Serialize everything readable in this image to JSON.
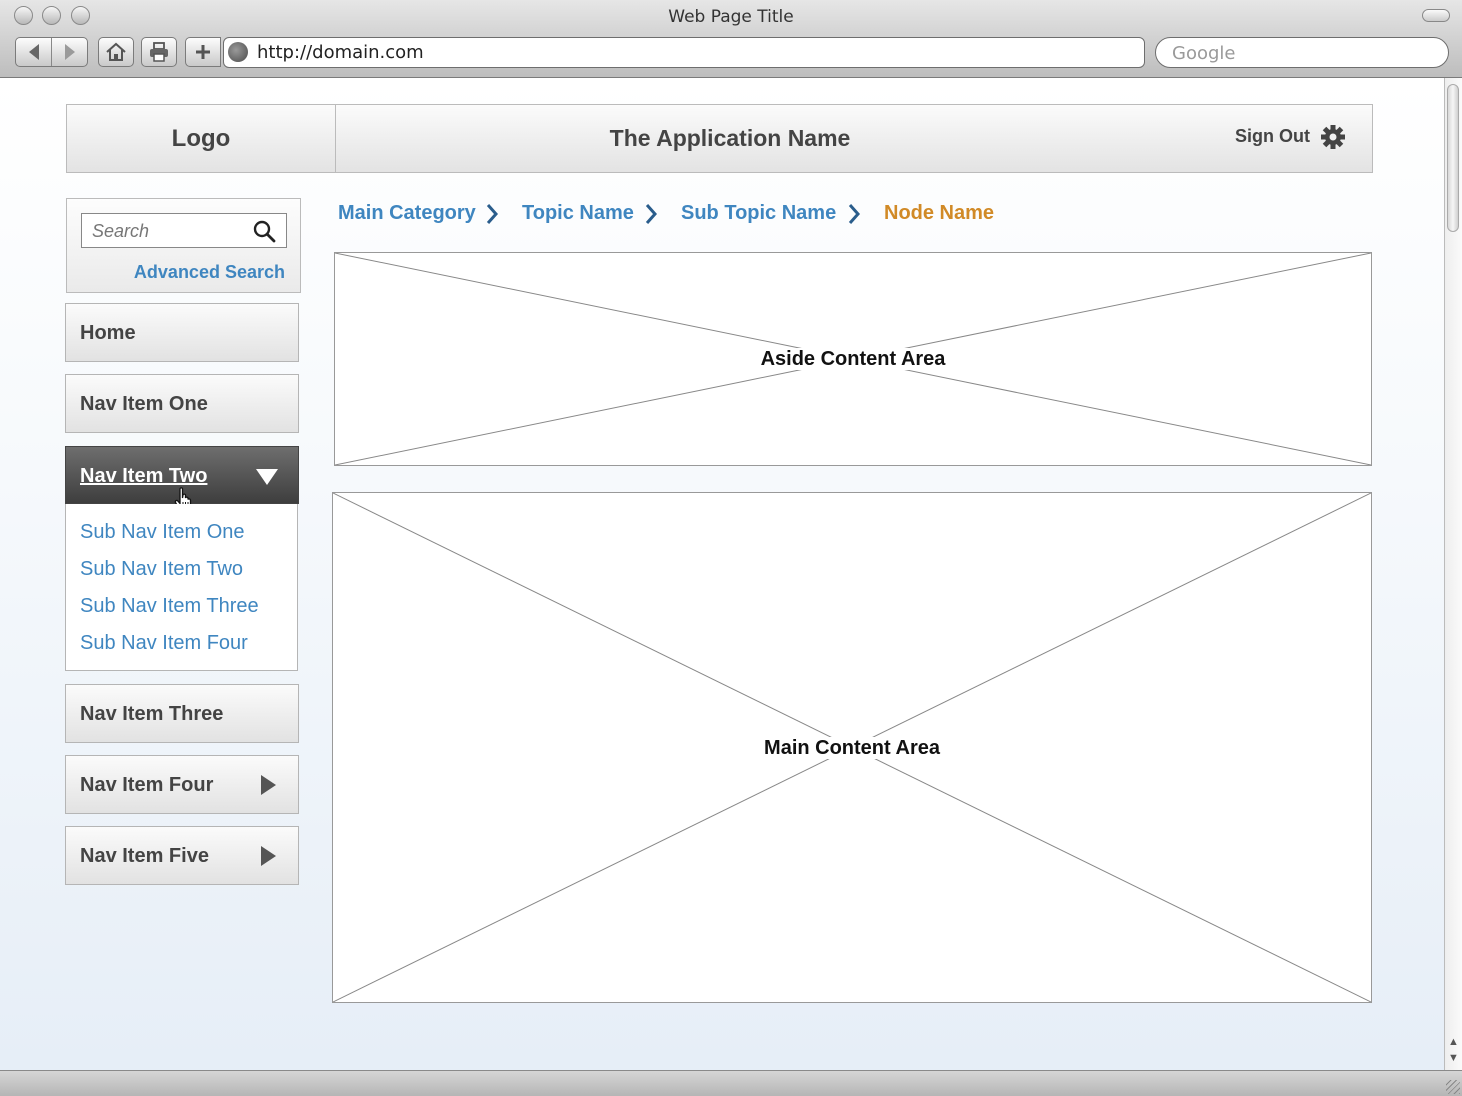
{
  "browser": {
    "window_title": "Web Page Title",
    "url": "http://domain.com",
    "search_placeholder": "Google"
  },
  "header": {
    "logo": "Logo",
    "app_name": "The Application Name",
    "sign_out": "Sign Out"
  },
  "search": {
    "placeholder": "Search",
    "advanced": "Advanced Search"
  },
  "nav": {
    "items": [
      {
        "label": "Home"
      },
      {
        "label": "Nav Item One"
      },
      {
        "label": "Nav Item Two",
        "active": true
      },
      {
        "label": "Nav Item Three"
      },
      {
        "label": "Nav Item Four",
        "has_submenu": true
      },
      {
        "label": "Nav Item Five",
        "has_submenu": true
      }
    ],
    "sub_items": [
      {
        "label": "Sub Nav Item One"
      },
      {
        "label": "Sub Nav Item Two"
      },
      {
        "label": "Sub Nav Item Three"
      },
      {
        "label": "Sub Nav Item Four"
      }
    ]
  },
  "breadcrumb": {
    "items": [
      {
        "label": "Main Category"
      },
      {
        "label": "Topic Name"
      },
      {
        "label": "Sub Topic Name"
      },
      {
        "label": "Node Name",
        "current": true
      }
    ]
  },
  "content": {
    "aside_label": "Aside Content Area",
    "main_label": "Main Content Area"
  },
  "colors": {
    "link": "#3f86c0",
    "current_crumb": "#d18a27",
    "chevron": "#2a5d8c",
    "active_nav": "#4a4a4a"
  },
  "icons": {
    "back": "back-arrow-icon",
    "forward": "forward-arrow-icon",
    "home": "home-icon",
    "print": "print-icon",
    "add": "plus-icon",
    "globe": "globe-icon",
    "search": "search-icon",
    "settings": "gear-icon",
    "cursor": "hand-cursor-icon"
  }
}
